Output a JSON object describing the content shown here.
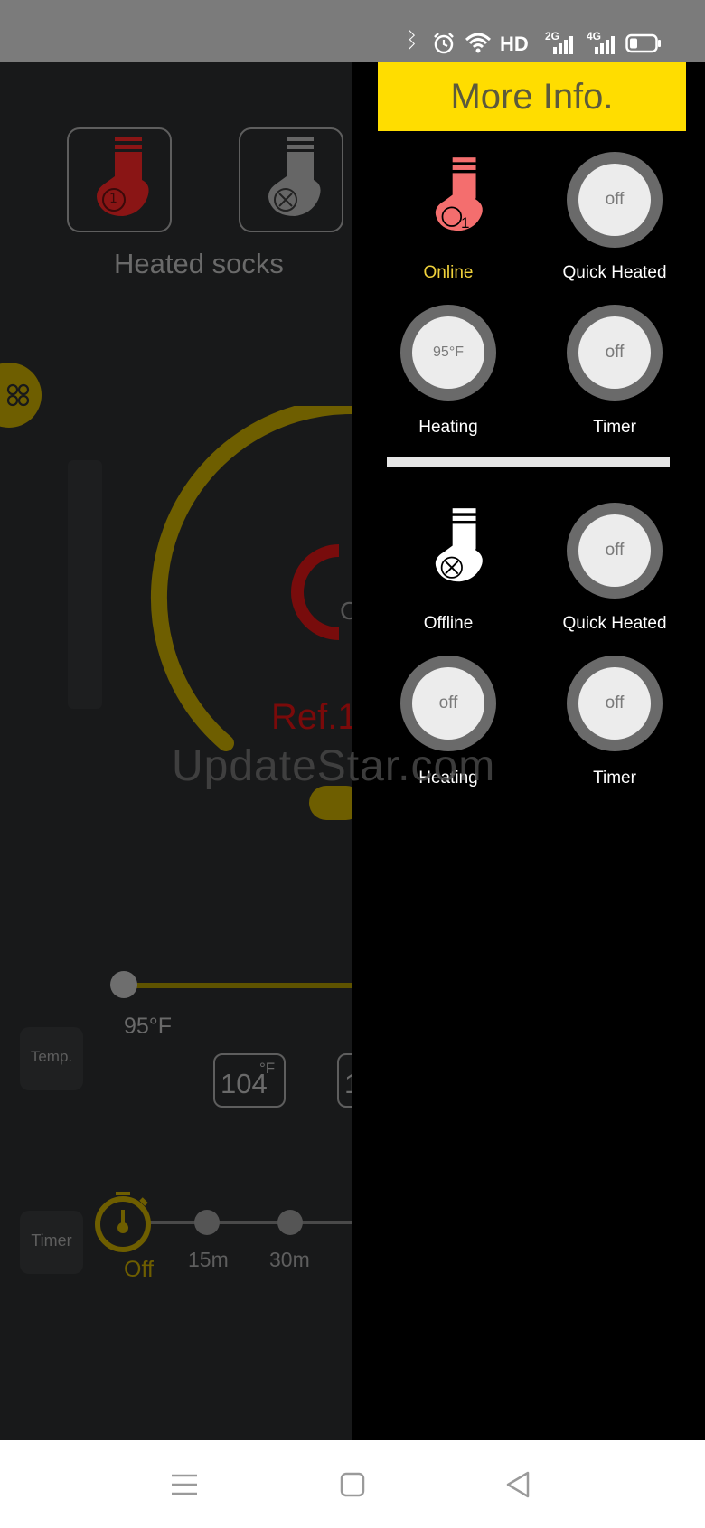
{
  "status_bar": {
    "network_label": "HD",
    "net_2g": "2G",
    "net_4g": "4G"
  },
  "main": {
    "device_title": "Heated socks",
    "sock1_badge": "1",
    "ref_label_partial": "Ref.1",
    "dial_partial_text": "C",
    "slider_min_label": "95°F",
    "temp_button": "Temp.",
    "temp_preset_1": "104",
    "temp_preset_unit": "°F",
    "temp_preset_2_partial": "1",
    "timer_button": "Timer",
    "timer_options": [
      "Off",
      "15m",
      "30m"
    ],
    "colors": {
      "accent": "#b49600",
      "alert": "#c41010"
    }
  },
  "drawer": {
    "title": "More Info.",
    "sock1": {
      "status": "Online",
      "badge": "1",
      "quick_heated_label": "Quick Heated",
      "quick_heated_value": "off",
      "heating_label": "Heating",
      "heating_value": "95°F",
      "timer_label": "Timer",
      "timer_value": "off"
    },
    "sock2": {
      "status": "Offline",
      "quick_heated_label": "Quick Heated",
      "quick_heated_value": "off",
      "heating_label": "Heating",
      "heating_value": "off",
      "timer_label": "Timer",
      "timer_value": "off"
    },
    "colors": {
      "header": "#ffdd00",
      "online": "#f0d23c",
      "sock_online": "#f46e6e"
    }
  },
  "watermark": "UpdateStar.com"
}
